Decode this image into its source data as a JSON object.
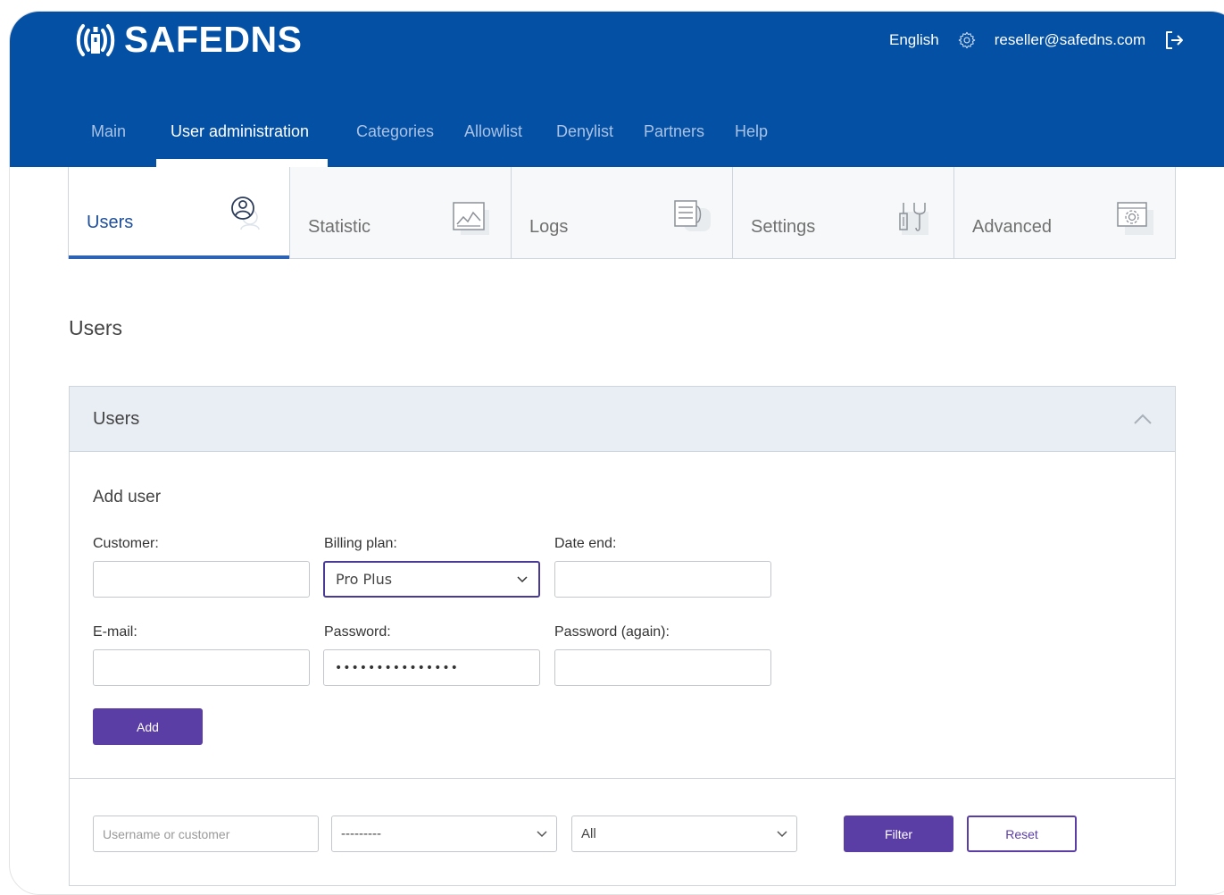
{
  "brand": {
    "name": "SAFEDNS"
  },
  "topbar": {
    "language": "English",
    "account_email": "reseller@safedns.com"
  },
  "main_nav": [
    {
      "label": "Main",
      "active": false
    },
    {
      "label": "User administration",
      "active": true
    },
    {
      "label": "Categories",
      "active": false
    },
    {
      "label": "Allowlist",
      "active": false
    },
    {
      "label": "Denylist",
      "active": false
    },
    {
      "label": "Partners",
      "active": false
    },
    {
      "label": "Help",
      "active": false
    }
  ],
  "sub_tabs": [
    {
      "label": "Users",
      "icon": "users-icon",
      "active": true
    },
    {
      "label": "Statistic",
      "icon": "statistic-chart-icon",
      "active": false
    },
    {
      "label": "Logs",
      "icon": "logs-icon",
      "active": false
    },
    {
      "label": "Settings",
      "icon": "settings-tools-icon",
      "active": false
    },
    {
      "label": "Advanced",
      "icon": "advanced-gear-icon",
      "active": false
    }
  ],
  "page": {
    "title": "Users"
  },
  "panel": {
    "title": "Users",
    "add_user": {
      "heading": "Add user",
      "customer_label": "Customer:",
      "customer_value": "",
      "billing_plan_label": "Billing plan:",
      "billing_plan_value": "Pro Plus",
      "date_end_label": "Date end:",
      "date_end_value": "",
      "email_label": "E-mail:",
      "email_value": "",
      "password_label": "Password:",
      "password_value": "•••••••••••••••",
      "password_again_label": "Password (again):",
      "password_again_value": "",
      "add_button": "Add"
    },
    "filter": {
      "search_placeholder": "Username or customer",
      "plan_select_value": "---------",
      "status_select_value": "All",
      "filter_button": "Filter",
      "reset_button": "Reset"
    }
  },
  "colors": {
    "header_bg": "#0350a4",
    "accent_purple": "#5b3ea5",
    "active_tab_underline": "#2c63b5",
    "panel_head_bg": "#e9eef5"
  }
}
